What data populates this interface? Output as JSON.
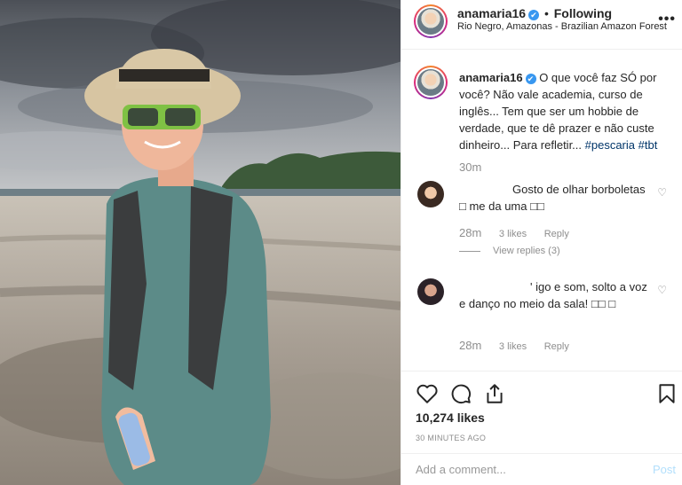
{
  "header": {
    "username": "anamaria16",
    "verified_glyph": "✔",
    "separator": "•",
    "follow_status": "Following",
    "location": "Rio Negro, Amazonas - Brazilian Amazon Forest",
    "more_icon": "more-options-icon"
  },
  "caption": {
    "username": "anamaria16",
    "verified_glyph": "✔",
    "text": "O que você faz SÓ por você? Não vale academia, curso de inglês... Tem que ser um hobbie de verdade, que te dê prazer e não custe dinheiro... Para refletir...",
    "hashtag1": "#pescaria",
    "hashtag2": "#tbt",
    "time": "30m"
  },
  "comments": [
    {
      "text": "Gosto de olhar borboletas □ me da uma □□",
      "time": "28m",
      "likes": "3 likes",
      "reply": "Reply",
      "view_replies": "View replies (3)"
    },
    {
      "text": "' igo e som, solto a voz e danço no meio da sala! □□ □",
      "time": "28m",
      "likes": "3 likes",
      "reply": "Reply"
    }
  ],
  "actions": {
    "icons": [
      "heart-icon",
      "comment-icon",
      "share-icon",
      "bookmark-icon"
    ],
    "likes_count": "10,274 likes",
    "time_ago": "30 MINUTES AGO"
  },
  "add_comment": {
    "placeholder": "Add a comment...",
    "post_label": "Post"
  },
  "colors": {
    "link": "#003569",
    "verified": "#3897f0",
    "muted": "#8e8e8e",
    "post_disabled": "#b2dffc"
  }
}
